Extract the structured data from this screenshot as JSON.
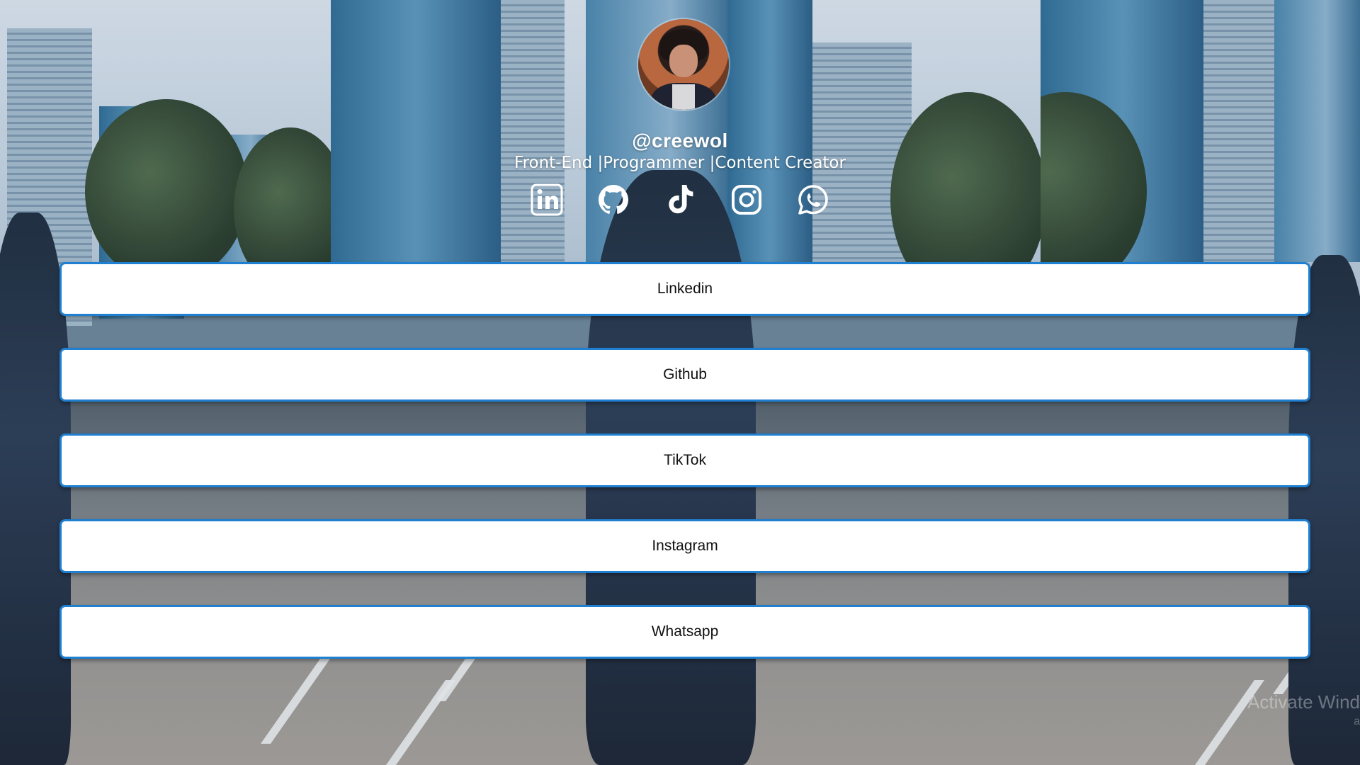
{
  "profile": {
    "avatar_alt": "profile photo",
    "username": "@creewol",
    "tagline": "Front-End |Programmer |Content Creator"
  },
  "social_icons": [
    {
      "name": "linkedin-icon"
    },
    {
      "name": "github-icon"
    },
    {
      "name": "tiktok-icon"
    },
    {
      "name": "instagram-icon"
    },
    {
      "name": "whatsapp-icon"
    }
  ],
  "links": [
    {
      "label": "Linkedin"
    },
    {
      "label": "Github"
    },
    {
      "label": "TikTok"
    },
    {
      "label": "Instagram"
    },
    {
      "label": "Whatsapp"
    }
  ],
  "watermark": {
    "line1": "Activate Wind",
    "line2": "a"
  },
  "colors": {
    "button_border": "#1f7fd0",
    "button_bg": "#ffffff",
    "header_text": "#ffffff"
  }
}
